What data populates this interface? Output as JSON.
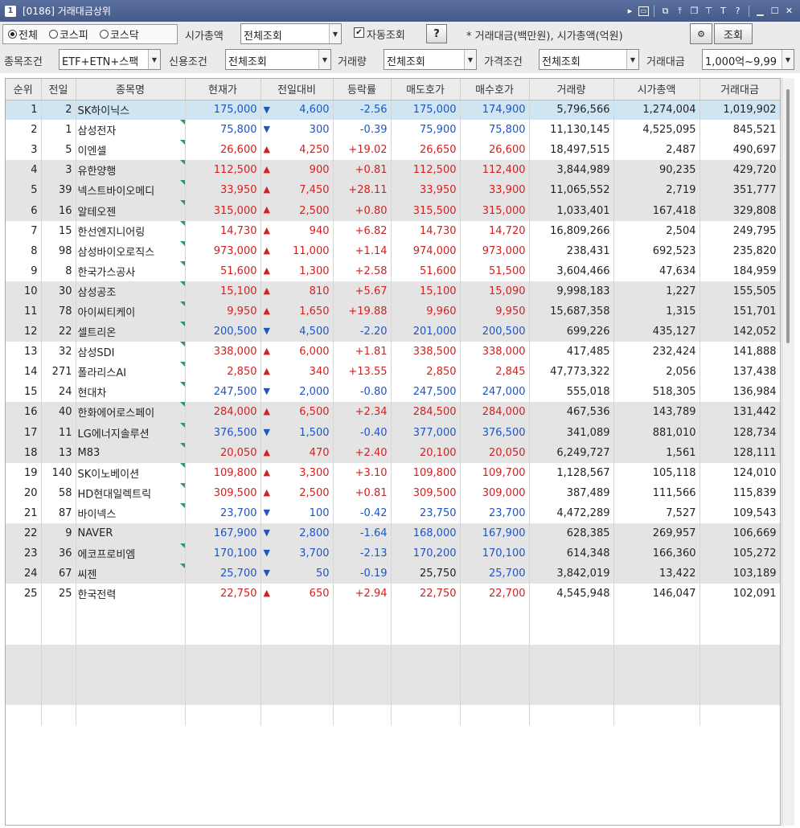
{
  "window": {
    "number": "1",
    "title": "[0186] 거래대금상위"
  },
  "titlebar_icons": [
    "arrow-right-icon",
    "screen-icon",
    "restore-icon",
    "pin-top-icon",
    "copy-window-icon",
    "pin-icon",
    "font-icon",
    "help-icon",
    "minimize-icon",
    "maximize-icon",
    "close-icon"
  ],
  "market": {
    "options": [
      "◉전체",
      "○코스피",
      "○코스닥"
    ],
    "labels": [
      "전체",
      "코스피",
      "코스닥"
    ],
    "selected": "전체"
  },
  "filters": {
    "market_cap_label": "시가총액",
    "market_cap_value": "전체조회",
    "auto_query_label": "자동조회",
    "auto_query_checked": true,
    "help_label": "?",
    "note": "* 거래대금(백만원), 시가총액(억원)",
    "query_button": "조회",
    "stock_cond_label": "종목조건",
    "stock_cond_value": "ETF+ETN+스팩",
    "credit_cond_label": "신용조건",
    "credit_cond_value": "전체조회",
    "volume_label": "거래량",
    "volume_value": "전체조회",
    "price_cond_label": "가격조건",
    "price_cond_value": "전체조회",
    "amount_label": "거래대금",
    "amount_value": "1,000억~9,99"
  },
  "colors": {
    "up": "#d32020",
    "down": "#1d55c4",
    "selected_row": "#cfe5f2",
    "new_marker": "#1aa260"
  },
  "table": {
    "headers": [
      "순위",
      "전일",
      "종목명",
      "현재가",
      "전일대비",
      "등락률",
      "매도호가",
      "매수호가",
      "거래량",
      "시가총액",
      "거래대금"
    ],
    "rows": [
      {
        "rank": "1",
        "prev": "2",
        "name": "SK하이닉스",
        "price": "175,000",
        "dir": "down",
        "change": "4,600",
        "rate": "-2.56",
        "ask": "175,000",
        "bid": "174,900",
        "volume": "5,796,566",
        "cap": "1,274,004",
        "amount": "1,019,902",
        "marker": false
      },
      {
        "rank": "2",
        "prev": "1",
        "name": "삼성전자",
        "price": "75,800",
        "dir": "down",
        "change": "300",
        "rate": "-0.39",
        "ask": "75,900",
        "bid": "75,800",
        "volume": "11,130,145",
        "cap": "4,525,095",
        "amount": "845,521",
        "marker": true
      },
      {
        "rank": "3",
        "prev": "5",
        "name": "이엔셀",
        "price": "26,600",
        "dir": "up",
        "change": "4,250",
        "rate": "+19.02",
        "ask": "26,650",
        "bid": "26,600",
        "volume": "18,497,515",
        "cap": "2,487",
        "amount": "490,697",
        "marker": true
      },
      {
        "rank": "4",
        "prev": "3",
        "name": "유한양행",
        "price": "112,500",
        "dir": "up",
        "change": "900",
        "rate": "+0.81",
        "ask": "112,500",
        "bid": "112,400",
        "volume": "3,844,989",
        "cap": "90,235",
        "amount": "429,720",
        "marker": true
      },
      {
        "rank": "5",
        "prev": "39",
        "name": "넥스트바이오메디",
        "price": "33,950",
        "dir": "up",
        "change": "7,450",
        "rate": "+28.11",
        "ask": "33,950",
        "bid": "33,900",
        "volume": "11,065,552",
        "cap": "2,719",
        "amount": "351,777",
        "marker": true
      },
      {
        "rank": "6",
        "prev": "16",
        "name": "알테오젠",
        "price": "315,000",
        "dir": "up",
        "change": "2,500",
        "rate": "+0.80",
        "ask": "315,500",
        "bid": "315,000",
        "volume": "1,033,401",
        "cap": "167,418",
        "amount": "329,808",
        "marker": true
      },
      {
        "rank": "7",
        "prev": "15",
        "name": "한선엔지니어링",
        "price": "14,730",
        "dir": "up",
        "change": "940",
        "rate": "+6.82",
        "ask": "14,730",
        "bid": "14,720",
        "volume": "16,809,266",
        "cap": "2,504",
        "amount": "249,795",
        "marker": true
      },
      {
        "rank": "8",
        "prev": "98",
        "name": "삼성바이오로직스",
        "price": "973,000",
        "dir": "up",
        "change": "11,000",
        "rate": "+1.14",
        "ask": "974,000",
        "bid": "973,000",
        "volume": "238,431",
        "cap": "692,523",
        "amount": "235,820",
        "marker": true
      },
      {
        "rank": "9",
        "prev": "8",
        "name": "한국가스공사",
        "price": "51,600",
        "dir": "up",
        "change": "1,300",
        "rate": "+2.58",
        "ask": "51,600",
        "bid": "51,500",
        "volume": "3,604,466",
        "cap": "47,634",
        "amount": "184,959",
        "marker": true
      },
      {
        "rank": "10",
        "prev": "30",
        "name": "삼성공조",
        "price": "15,100",
        "dir": "up",
        "change": "810",
        "rate": "+5.67",
        "ask": "15,100",
        "bid": "15,090",
        "volume": "9,998,183",
        "cap": "1,227",
        "amount": "155,505",
        "marker": true
      },
      {
        "rank": "11",
        "prev": "78",
        "name": "아이씨티케이",
        "price": "9,950",
        "dir": "up",
        "change": "1,650",
        "rate": "+19.88",
        "ask": "9,960",
        "bid": "9,950",
        "volume": "15,687,358",
        "cap": "1,315",
        "amount": "151,701",
        "marker": true
      },
      {
        "rank": "12",
        "prev": "22",
        "name": "셀트리온",
        "price": "200,500",
        "dir": "down",
        "change": "4,500",
        "rate": "-2.20",
        "ask": "201,000",
        "bid": "200,500",
        "volume": "699,226",
        "cap": "435,127",
        "amount": "142,052",
        "marker": true
      },
      {
        "rank": "13",
        "prev": "32",
        "name": "삼성SDI",
        "price": "338,000",
        "dir": "up",
        "change": "6,000",
        "rate": "+1.81",
        "ask": "338,500",
        "bid": "338,000",
        "volume": "417,485",
        "cap": "232,424",
        "amount": "141,888",
        "marker": true
      },
      {
        "rank": "14",
        "prev": "271",
        "name": "폴라리스AI",
        "price": "2,850",
        "dir": "up",
        "change": "340",
        "rate": "+13.55",
        "ask": "2,850",
        "bid": "2,845",
        "volume": "47,773,322",
        "cap": "2,056",
        "amount": "137,438",
        "marker": true
      },
      {
        "rank": "15",
        "prev": "24",
        "name": "현대차",
        "price": "247,500",
        "dir": "down",
        "change": "2,000",
        "rate": "-0.80",
        "ask": "247,500",
        "bid": "247,000",
        "volume": "555,018",
        "cap": "518,305",
        "amount": "136,984",
        "marker": true
      },
      {
        "rank": "16",
        "prev": "40",
        "name": "한화에어로스페이",
        "price": "284,000",
        "dir": "up",
        "change": "6,500",
        "rate": "+2.34",
        "ask": "284,500",
        "bid": "284,000",
        "volume": "467,536",
        "cap": "143,789",
        "amount": "131,442",
        "marker": true
      },
      {
        "rank": "17",
        "prev": "11",
        "name": "LG에너지솔루션",
        "price": "376,500",
        "dir": "down",
        "change": "1,500",
        "rate": "-0.40",
        "ask": "377,000",
        "bid": "376,500",
        "volume": "341,089",
        "cap": "881,010",
        "amount": "128,734",
        "marker": true
      },
      {
        "rank": "18",
        "prev": "13",
        "name": "M83",
        "price": "20,050",
        "dir": "up",
        "change": "470",
        "rate": "+2.40",
        "ask": "20,100",
        "bid": "20,050",
        "volume": "6,249,727",
        "cap": "1,561",
        "amount": "128,111",
        "marker": true
      },
      {
        "rank": "19",
        "prev": "140",
        "name": "SK이노베이션",
        "price": "109,800",
        "dir": "up",
        "change": "3,300",
        "rate": "+3.10",
        "ask": "109,800",
        "bid": "109,700",
        "volume": "1,128,567",
        "cap": "105,118",
        "amount": "124,010",
        "marker": true
      },
      {
        "rank": "20",
        "prev": "58",
        "name": "HD현대일렉트릭",
        "price": "309,500",
        "dir": "up",
        "change": "2,500",
        "rate": "+0.81",
        "ask": "309,500",
        "bid": "309,000",
        "volume": "387,489",
        "cap": "111,566",
        "amount": "115,839",
        "marker": true
      },
      {
        "rank": "21",
        "prev": "87",
        "name": "바이넥스",
        "price": "23,700",
        "dir": "down",
        "change": "100",
        "rate": "-0.42",
        "ask": "23,750",
        "bid": "23,700",
        "volume": "4,472,289",
        "cap": "7,527",
        "amount": "109,543",
        "marker": true
      },
      {
        "rank": "22",
        "prev": "9",
        "name": "NAVER",
        "price": "167,900",
        "dir": "down",
        "change": "2,800",
        "rate": "-1.64",
        "ask": "168,000",
        "bid": "167,900",
        "volume": "628,385",
        "cap": "269,957",
        "amount": "106,669",
        "marker": false
      },
      {
        "rank": "23",
        "prev": "36",
        "name": "에코프로비엠",
        "price": "170,100",
        "dir": "down",
        "change": "3,700",
        "rate": "-2.13",
        "ask": "170,200",
        "bid": "170,100",
        "volume": "614,348",
        "cap": "166,360",
        "amount": "105,272",
        "marker": true
      },
      {
        "rank": "24",
        "prev": "67",
        "name": "씨젠",
        "price": "25,700",
        "dir": "down",
        "change": "50",
        "rate": "-0.19",
        "ask": "25,750",
        "bid": "25,700",
        "volume": "3,842,019",
        "cap": "13,422",
        "amount": "103,189",
        "marker": true
      },
      {
        "rank": "25",
        "prev": "25",
        "name": "한국전력",
        "price": "22,750",
        "dir": "up",
        "change": "650",
        "rate": "+2.94",
        "ask": "22,750",
        "bid": "22,700",
        "volume": "4,545,948",
        "cap": "146,047",
        "amount": "102,091",
        "marker": false
      }
    ]
  }
}
